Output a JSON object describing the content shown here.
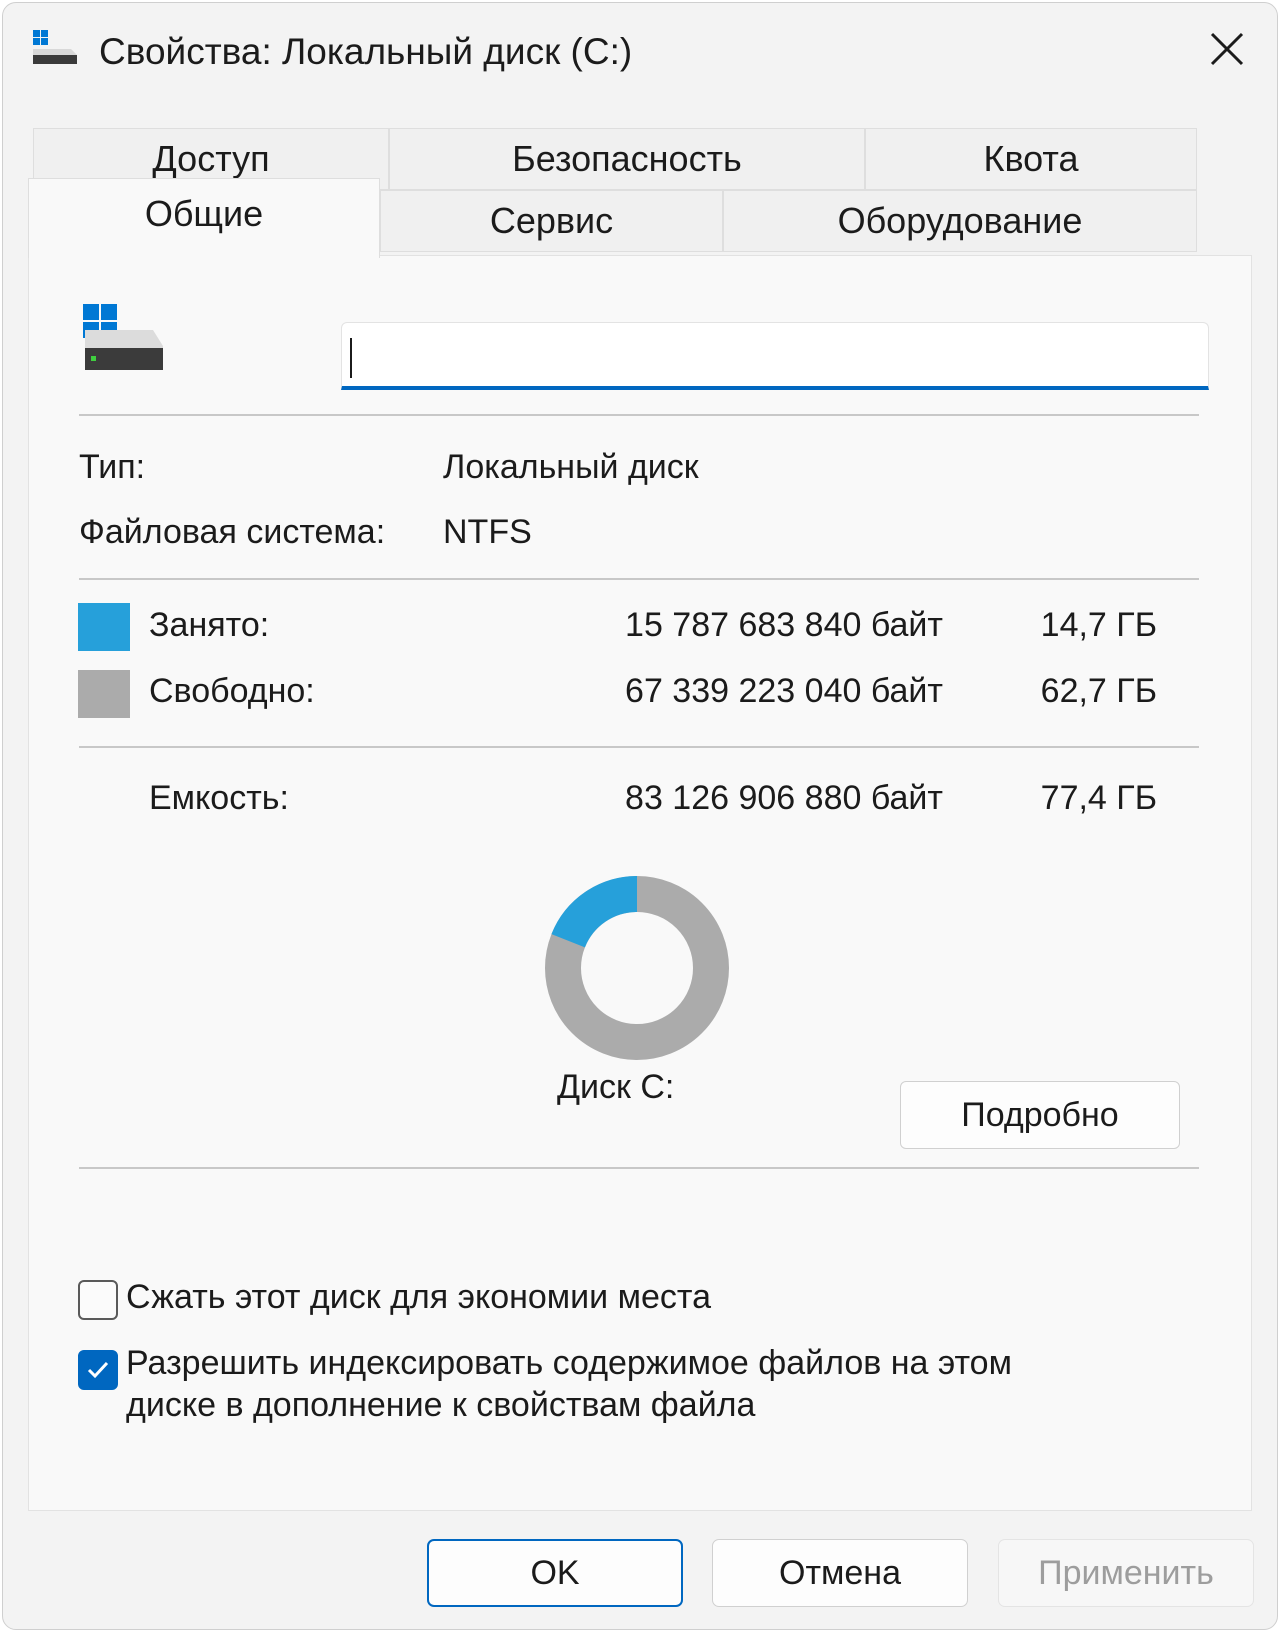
{
  "window": {
    "title": "Свойства: Локальный диск (C:)"
  },
  "tabs": {
    "row1": [
      "Доступ",
      "Безопасность",
      "Квота"
    ],
    "row2": [
      "Общие",
      "Сервис",
      "Оборудование"
    ],
    "active": "Общие"
  },
  "general": {
    "name_value": "",
    "type_label": "Тип:",
    "type_value": "Локальный диск",
    "fs_label": "Файловая система:",
    "fs_value": "NTFS",
    "used_label": "Занято:",
    "used_bytes": "15 787 683 840 байт",
    "used_size": "14,7 ГБ",
    "free_label": "Свободно:",
    "free_bytes": "67 339 223 040 байт",
    "free_size": "62,7 ГБ",
    "capacity_label": "Емкость:",
    "capacity_bytes": "83 126 906 880 байт",
    "capacity_size": "77,4 ГБ",
    "disk_label": "Диск C:",
    "details_button": "Подробно",
    "compress_label": "Сжать этот диск для экономии места",
    "compress_checked": false,
    "index_label_line1": "Разрешить индексировать содержимое файлов на этом",
    "index_label_line2": "диске в дополнение к свойствам файла",
    "index_checked": true,
    "colors": {
      "used": "#26a0da",
      "free": "#ababab"
    },
    "used_fraction": 0.19
  },
  "buttons": {
    "ok": "OK",
    "cancel": "Отмена",
    "apply": "Применить"
  },
  "icons": [
    "drive-icon",
    "close-icon",
    "check-icon"
  ]
}
